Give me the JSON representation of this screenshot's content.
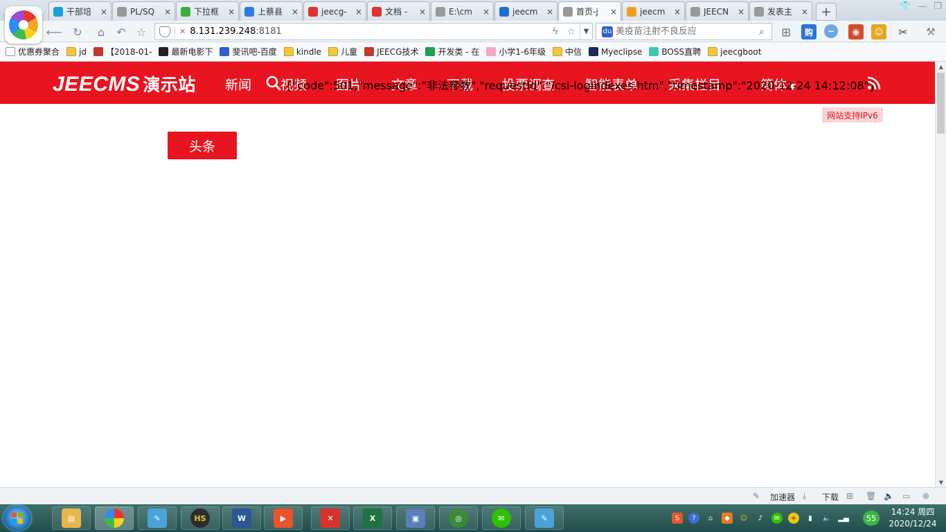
{
  "browser": {
    "tabs": [
      {
        "label": "干部培",
        "icon_color": "#1aa0d8",
        "active": false
      },
      {
        "label": "PL/SQ",
        "icon_color": "#999999",
        "active": false
      },
      {
        "label": "下拉框",
        "icon_color": "#3cae3c",
        "active": false
      },
      {
        "label": "上蔡县",
        "icon_color": "#2d7be0",
        "active": false
      },
      {
        "label": "jeecg-",
        "icon_color": "#e03030",
        "active": false
      },
      {
        "label": "文档 -",
        "icon_color": "#e03030",
        "active": false
      },
      {
        "label": "E:\\cm",
        "icon_color": "#999999",
        "active": false
      },
      {
        "label": "jeecm",
        "icon_color": "#1f6fd0",
        "active": false
      },
      {
        "label": "首页-j",
        "icon_color": "#999999",
        "active": true
      },
      {
        "label": "jeecm",
        "icon_color": "#f0a020",
        "active": false
      },
      {
        "label": "JEECN",
        "icon_color": "#999999",
        "active": false
      },
      {
        "label": "发表主",
        "icon_color": "#999999",
        "active": false
      }
    ],
    "new_tab_label": "+",
    "tab_close_glyph": "×",
    "address": {
      "host": "8.131.239.248",
      "port": ":8181"
    },
    "search": {
      "placeholder": "美疫苗注射不良反应"
    },
    "bookmarks": [
      {
        "label": "优惠券聚合",
        "kind": "page"
      },
      {
        "label": "jd",
        "kind": "folder"
      },
      {
        "label": "【2018-01-",
        "kind": "img"
      },
      {
        "label": "最新电影下",
        "kind": "6v"
      },
      {
        "label": "斐讯吧-百度",
        "kind": "baidu"
      },
      {
        "label": "kindle",
        "kind": "folder"
      },
      {
        "label": "儿童",
        "kind": "folder"
      },
      {
        "label": "JEECG技术",
        "kind": "img"
      },
      {
        "label": "开发类 - 在",
        "kind": "green"
      },
      {
        "label": "小学1-6年级",
        "kind": "pig"
      },
      {
        "label": "中信",
        "kind": "folder"
      },
      {
        "label": "Myeclipse",
        "kind": "me"
      },
      {
        "label": "BOSS直聘",
        "kind": "boss"
      },
      {
        "label": "jeecgboot",
        "kind": "folder"
      }
    ]
  },
  "site": {
    "brand": {
      "latin": "JEECMS",
      "cn": "演示站"
    },
    "nav": [
      "新闻",
      "视频",
      "图片",
      "文章",
      "下载",
      "投票调查",
      "智能表单",
      "采集栏目"
    ],
    "lang": "简体",
    "overlay_text": "{\"code\":501,\"message\":\"非法参数\",\"requestId\":\"/csi-logIndexes.htm\",\"timestamp\":\"2020-12-24 14:12:08\"}",
    "ipv6_badge": "网站支持IPv6",
    "headline_button": "头条",
    "brand_color": "#e8141f"
  },
  "statusbar": {
    "accelerator": "加速器",
    "download": "下载"
  },
  "taskbar": {
    "clock_time": "14:24 周四",
    "clock_date": "2020/12/24",
    "perf_value": "55"
  }
}
